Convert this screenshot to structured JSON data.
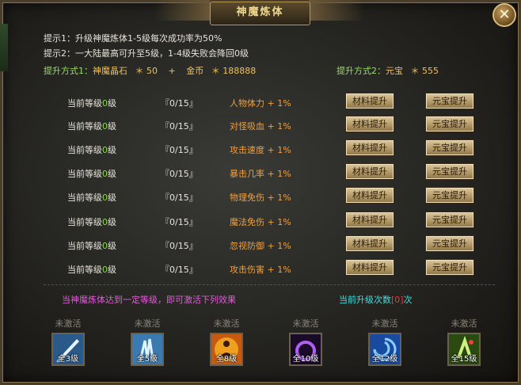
{
  "window": {
    "title": "神魔炼体",
    "close_icon": "✕"
  },
  "tips": {
    "line1": "提示1：升级神魔炼体1-5级每次成功率为50%",
    "line2": "提示2：一大陆最高可升至5级，1-4级失败会降回0级"
  },
  "methods": {
    "m1_label": "提升方式1：",
    "m1_item": "神魔晶石",
    "m1_item_cost": "＊ 50",
    "m1_plus": "+",
    "m1_gold": "金币",
    "m1_gold_cost": "＊ 188888",
    "m2_label": "提升方式2：",
    "m2_item": "元宝",
    "m2_cost": "＊ 555"
  },
  "rows": [
    {
      "level_prefix": "当前等级",
      "level": "0",
      "level_suffix": "级",
      "progress": "『0/15』",
      "attr": "人物体力",
      "bonus": "+ 1%",
      "btn_material": "材料提升",
      "btn_yuanbao": "元宝提升"
    },
    {
      "level_prefix": "当前等级",
      "level": "0",
      "level_suffix": "级",
      "progress": "『0/15』",
      "attr": "对怪吸血",
      "bonus": "+ 1%",
      "btn_material": "材料提升",
      "btn_yuanbao": "元宝提升"
    },
    {
      "level_prefix": "当前等级",
      "level": "0",
      "level_suffix": "级",
      "progress": "『0/15』",
      "attr": "攻击速度",
      "bonus": "+ 1%",
      "btn_material": "材料提升",
      "btn_yuanbao": "元宝提升"
    },
    {
      "level_prefix": "当前等级",
      "level": "0",
      "level_suffix": "级",
      "progress": "『0/15』",
      "attr": "暴击几率",
      "bonus": "+ 1%",
      "btn_material": "材料提升",
      "btn_yuanbao": "元宝提升"
    },
    {
      "level_prefix": "当前等级",
      "level": "0",
      "level_suffix": "级",
      "progress": "『0/15』",
      "attr": "物理免伤",
      "bonus": "+ 1%",
      "btn_material": "材料提升",
      "btn_yuanbao": "元宝提升"
    },
    {
      "level_prefix": "当前等级",
      "level": "0",
      "level_suffix": "级",
      "progress": "『0/15』",
      "attr": "魔法免伤",
      "bonus": "+ 1%",
      "btn_material": "材料提升",
      "btn_yuanbao": "元宝提升"
    },
    {
      "level_prefix": "当前等级",
      "level": "0",
      "level_suffix": "级",
      "progress": "『0/15』",
      "attr": "忽视防御",
      "bonus": "+ 1%",
      "btn_material": "材料提升",
      "btn_yuanbao": "元宝提升"
    },
    {
      "level_prefix": "当前等级",
      "level": "0",
      "level_suffix": "级",
      "progress": "『0/15』",
      "attr": "攻击伤害",
      "bonus": "+ 1%",
      "btn_material": "材料提升",
      "btn_yuanbao": "元宝提升"
    }
  ],
  "footer": {
    "notice": "当神魔炼体达到一定等级，即可激活下列效果",
    "count_prefix": "当前升级次数",
    "count_value": "[0]",
    "count_suffix": "次"
  },
  "skills": [
    {
      "status": "未激活",
      "caption": "全3级",
      "icon": "blade-icon",
      "color": "#2a5a8a"
    },
    {
      "status": "未激活",
      "caption": "全5级",
      "icon": "frost-claw-icon",
      "color": "#3a7ab0"
    },
    {
      "status": "未激活",
      "caption": "全8级",
      "icon": "meditation-icon",
      "color": "#c85a10"
    },
    {
      "status": "未激活",
      "caption": "全10级",
      "icon": "ring-icon",
      "color": "#5a2a8a"
    },
    {
      "status": "未激活",
      "caption": "全12级",
      "icon": "vortex-icon",
      "color": "#1a4aa0"
    },
    {
      "status": "未激活",
      "caption": "全15级",
      "icon": "rune-icon",
      "color": "#4a8a2a"
    }
  ]
}
